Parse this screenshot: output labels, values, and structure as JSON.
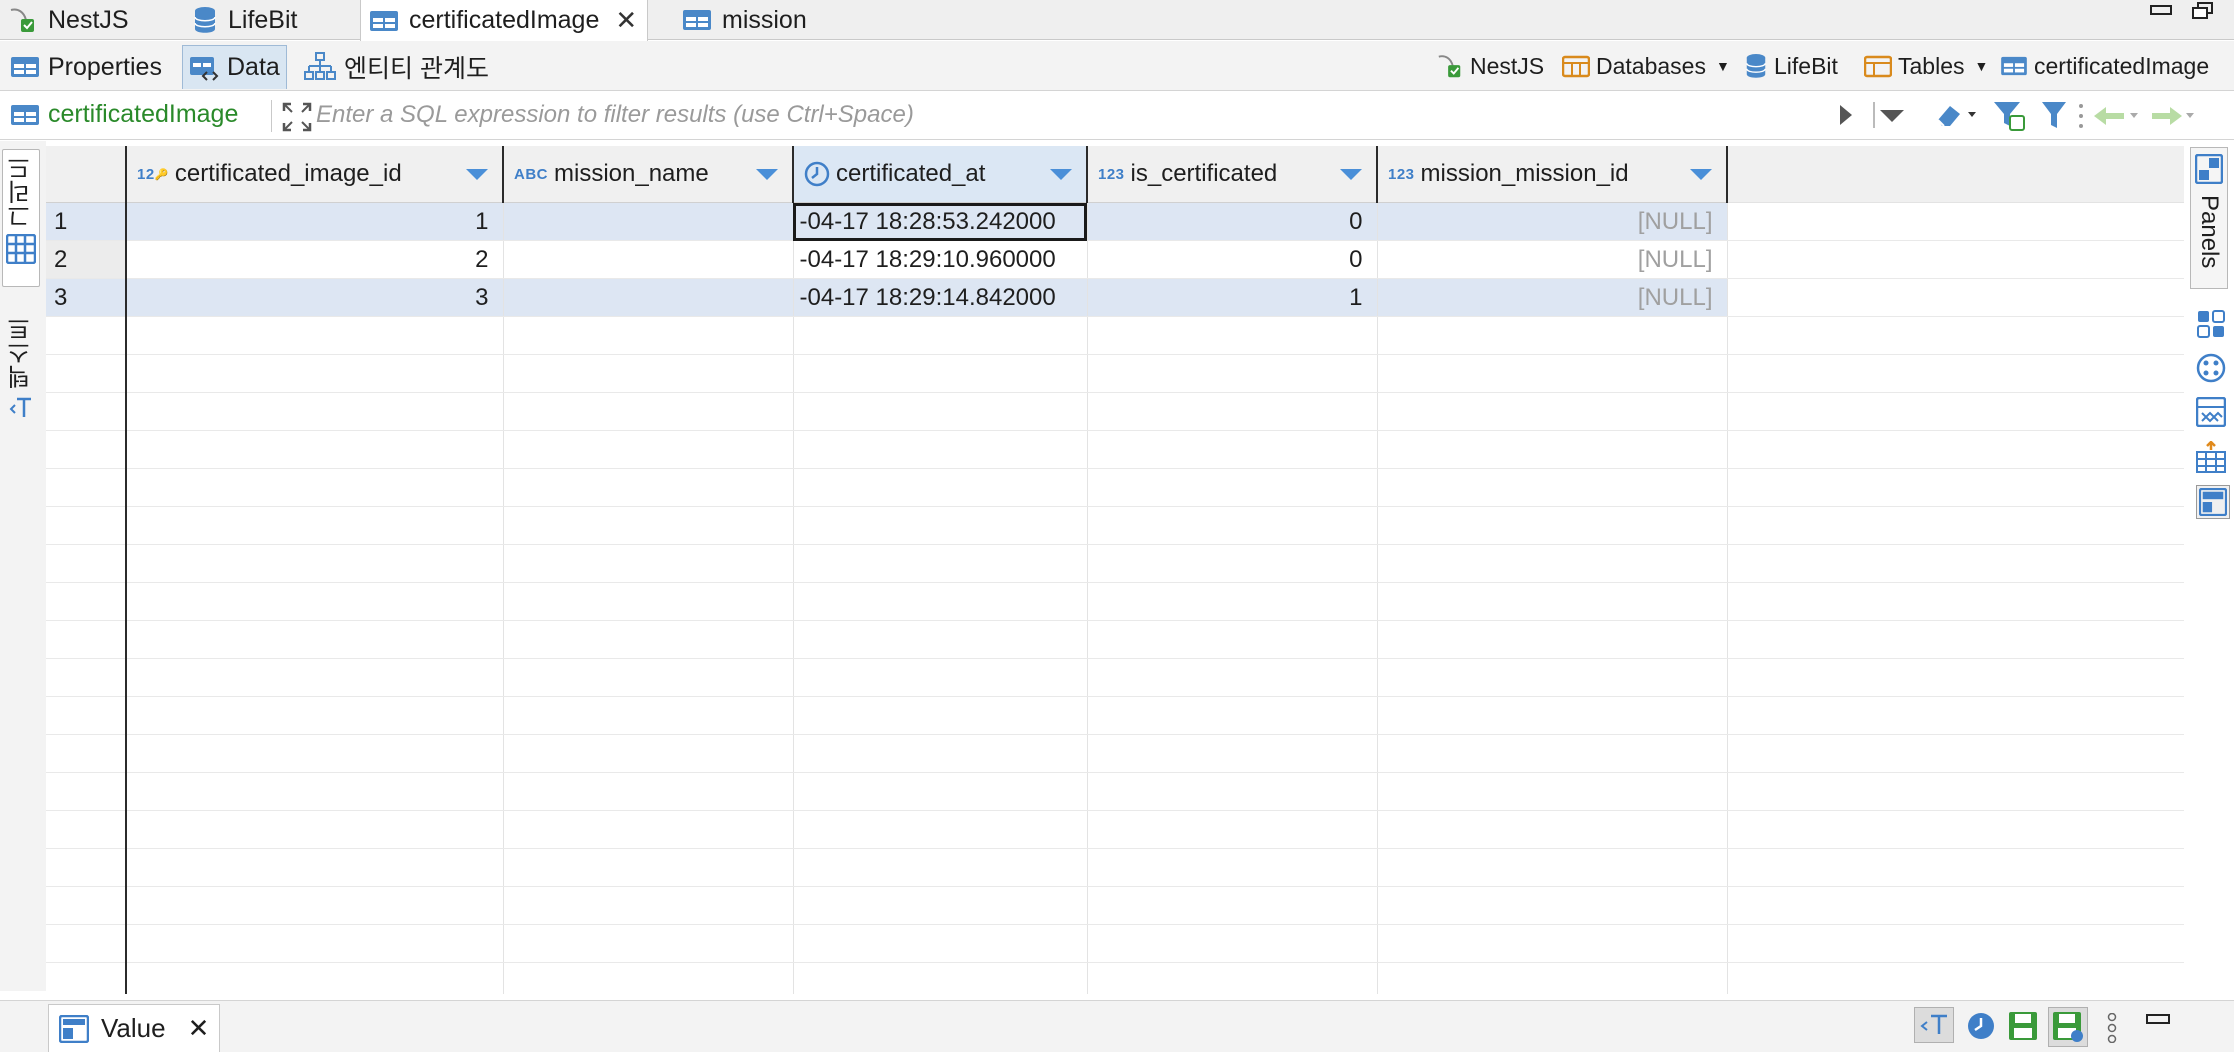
{
  "editor_tabs": [
    {
      "label": "NestJS",
      "icon": "connection-icon"
    },
    {
      "label": "LifeBit",
      "icon": "database-icon"
    },
    {
      "label": "certificatedImage",
      "icon": "table-icon",
      "active": true
    },
    {
      "label": "mission",
      "icon": "table-icon"
    }
  ],
  "subtabs": [
    {
      "label": "Properties"
    },
    {
      "label": "Data"
    },
    {
      "label": "엔티티 관계도"
    }
  ],
  "breadcrumb": [
    {
      "label": "NestJS"
    },
    {
      "label": "Databases"
    },
    {
      "label": "LifeBit"
    },
    {
      "label": "Tables"
    },
    {
      "label": "certificatedImage"
    }
  ],
  "filter": {
    "table_name": "certificatedImage",
    "placeholder": "Enter a SQL expression to filter results (use Ctrl+Space)"
  },
  "left_sidebar": {
    "grid_label": "그리드",
    "text_label": "텍스트"
  },
  "right_sidebar": {
    "panels_label": "Panels"
  },
  "grid": {
    "columns": [
      {
        "name": "certificated_image_id",
        "type": "123"
      },
      {
        "name": "mission_name",
        "type": "ABC"
      },
      {
        "name": "certificated_at",
        "type": "clock"
      },
      {
        "name": "is_certificated",
        "type": "123"
      },
      {
        "name": "mission_mission_id",
        "type": "123"
      }
    ],
    "rows": [
      {
        "num": "1",
        "certificated_image_id": "1",
        "mission_name": "",
        "certificated_at": "-04-17 18:28:53.242000",
        "is_certificated": "0",
        "mission_mission_id": "[NULL]"
      },
      {
        "num": "2",
        "certificated_image_id": "2",
        "mission_name": "",
        "certificated_at": "-04-17 18:29:10.960000",
        "is_certificated": "0",
        "mission_mission_id": "[NULL]"
      },
      {
        "num": "3",
        "certificated_image_id": "3",
        "mission_name": "",
        "certificated_at": "-04-17 18:29:14.842000",
        "is_certificated": "1",
        "mission_mission_id": "[NULL]"
      }
    ]
  },
  "bottom_panel": {
    "value_tab": "Value"
  },
  "colors": {
    "accent": "#4a8fd8",
    "selected_row": "#dde6f3",
    "table_name_green": "#2a8a2a"
  }
}
